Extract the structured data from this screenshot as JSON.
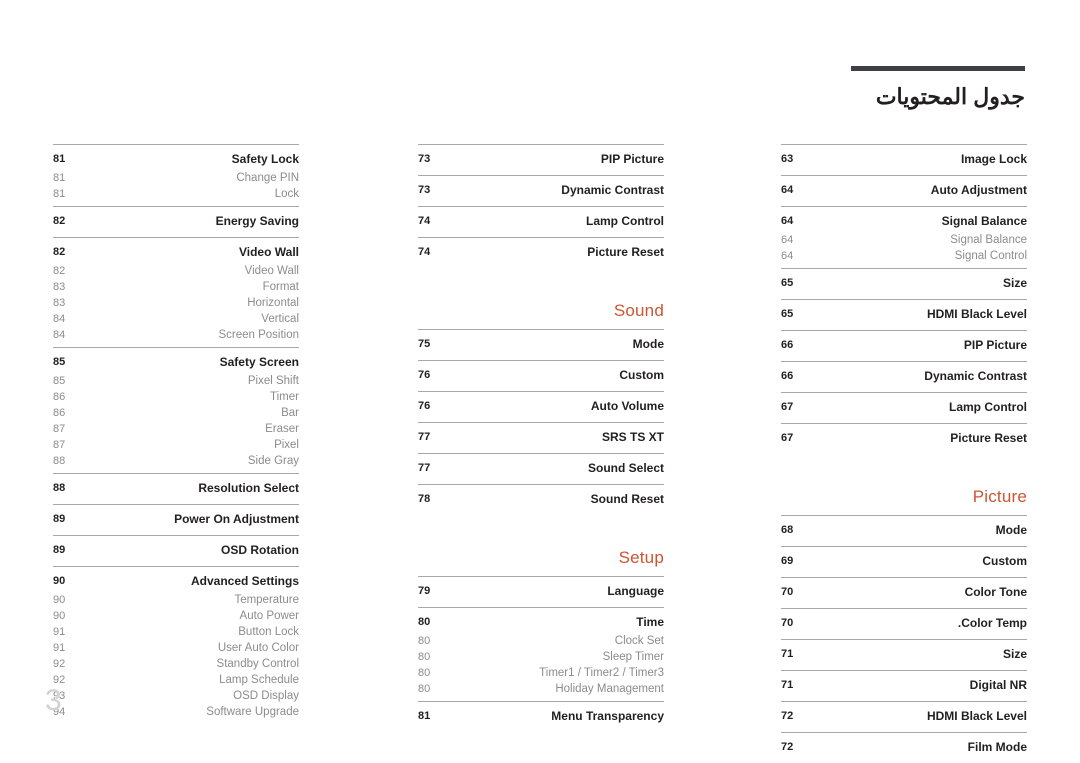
{
  "header": {
    "title": "جدول المحتويات",
    "rule_color": "#3f3f4a"
  },
  "theme": {
    "accent": "#cc5533",
    "main_text": "#231f20",
    "sub_text": "#8c8c8c",
    "rule": "#a8a8a8",
    "folio_color": "#d2d2d2",
    "background": "#ffffff"
  },
  "folio": "3",
  "columns": [
    {
      "id": "column-1",
      "sections": [
        {
          "heading": null,
          "groups": [
            {
              "rows": [
                {
                  "page": "81",
                  "label": "Safety Lock",
                  "level": "main"
                },
                {
                  "page": "81",
                  "label": "Change PIN",
                  "level": "sub"
                },
                {
                  "page": "81",
                  "label": "Lock",
                  "level": "sub"
                }
              ]
            },
            {
              "rows": [
                {
                  "page": "82",
                  "label": "Energy Saving",
                  "level": "main"
                }
              ]
            },
            {
              "rows": [
                {
                  "page": "82",
                  "label": "Video Wall",
                  "level": "main"
                },
                {
                  "page": "82",
                  "label": "Video Wall",
                  "level": "sub"
                },
                {
                  "page": "83",
                  "label": "Format",
                  "level": "sub"
                },
                {
                  "page": "83",
                  "label": "Horizontal",
                  "level": "sub"
                },
                {
                  "page": "84",
                  "label": "Vertical",
                  "level": "sub"
                },
                {
                  "page": "84",
                  "label": "Screen Position",
                  "level": "sub"
                }
              ]
            },
            {
              "rows": [
                {
                  "page": "85",
                  "label": "Safety Screen",
                  "level": "main"
                },
                {
                  "page": "85",
                  "label": "Pixel Shift",
                  "level": "sub"
                },
                {
                  "page": "86",
                  "label": "Timer",
                  "level": "sub"
                },
                {
                  "page": "86",
                  "label": "Bar",
                  "level": "sub"
                },
                {
                  "page": "87",
                  "label": "Eraser",
                  "level": "sub"
                },
                {
                  "page": "87",
                  "label": "Pixel",
                  "level": "sub"
                },
                {
                  "page": "88",
                  "label": "Side Gray",
                  "level": "sub"
                }
              ]
            },
            {
              "rows": [
                {
                  "page": "88",
                  "label": "Resolution Select",
                  "level": "main"
                }
              ]
            },
            {
              "rows": [
                {
                  "page": "89",
                  "label": "Power On Adjustment",
                  "level": "main"
                }
              ]
            },
            {
              "rows": [
                {
                  "page": "89",
                  "label": "OSD Rotation",
                  "level": "main"
                }
              ]
            },
            {
              "rows": [
                {
                  "page": "90",
                  "label": "Advanced Settings",
                  "level": "main"
                },
                {
                  "page": "90",
                  "label": "Temperature",
                  "level": "sub"
                },
                {
                  "page": "90",
                  "label": "Auto Power",
                  "level": "sub"
                },
                {
                  "page": "91",
                  "label": "Button Lock",
                  "level": "sub"
                },
                {
                  "page": "91",
                  "label": "User Auto Color",
                  "level": "sub"
                },
                {
                  "page": "92",
                  "label": "Standby Control",
                  "level": "sub"
                },
                {
                  "page": "92",
                  "label": "Lamp Schedule",
                  "level": "sub"
                },
                {
                  "page": "93",
                  "label": "OSD Display",
                  "level": "sub"
                },
                {
                  "page": "94",
                  "label": "Software Upgrade",
                  "level": "sub"
                }
              ]
            }
          ]
        }
      ]
    },
    {
      "id": "column-2",
      "sections": [
        {
          "heading": null,
          "groups": [
            {
              "rows": [
                {
                  "page": "73",
                  "label": "PIP Picture",
                  "level": "main"
                }
              ]
            },
            {
              "rows": [
                {
                  "page": "73",
                  "label": "Dynamic Contrast",
                  "level": "main"
                }
              ]
            },
            {
              "rows": [
                {
                  "page": "74",
                  "label": "Lamp Control",
                  "level": "main"
                }
              ]
            },
            {
              "rows": [
                {
                  "page": "74",
                  "label": "Picture Reset",
                  "level": "main"
                }
              ]
            }
          ]
        },
        {
          "heading": "Sound",
          "groups": [
            {
              "rows": [
                {
                  "page": "75",
                  "label": "Mode",
                  "level": "main"
                }
              ]
            },
            {
              "rows": [
                {
                  "page": "76",
                  "label": "Custom",
                  "level": "main"
                }
              ]
            },
            {
              "rows": [
                {
                  "page": "76",
                  "label": "Auto Volume",
                  "level": "main"
                }
              ]
            },
            {
              "rows": [
                {
                  "page": "77",
                  "label": "SRS TS XT",
                  "level": "main"
                }
              ]
            },
            {
              "rows": [
                {
                  "page": "77",
                  "label": "Sound Select",
                  "level": "main"
                }
              ]
            },
            {
              "rows": [
                {
                  "page": "78",
                  "label": "Sound Reset",
                  "level": "main"
                }
              ]
            }
          ]
        },
        {
          "heading": "Setup",
          "groups": [
            {
              "rows": [
                {
                  "page": "79",
                  "label": "Language",
                  "level": "main"
                }
              ]
            },
            {
              "rows": [
                {
                  "page": "80",
                  "label": "Time",
                  "level": "main"
                },
                {
                  "page": "80",
                  "label": "Clock Set",
                  "level": "sub"
                },
                {
                  "page": "80",
                  "label": "Sleep Timer",
                  "level": "sub"
                },
                {
                  "page": "80",
                  "label": "Timer1 / Timer2 / Timer3",
                  "level": "sub"
                },
                {
                  "page": "80",
                  "label": "Holiday Management",
                  "level": "sub"
                }
              ]
            },
            {
              "rows": [
                {
                  "page": "81",
                  "label": "Menu Transparency",
                  "level": "main"
                }
              ]
            }
          ]
        }
      ]
    },
    {
      "id": "column-3",
      "sections": [
        {
          "heading": null,
          "groups": [
            {
              "rows": [
                {
                  "page": "63",
                  "label": "Image Lock",
                  "level": "main"
                }
              ]
            },
            {
              "rows": [
                {
                  "page": "64",
                  "label": "Auto Adjustment",
                  "level": "main"
                }
              ]
            },
            {
              "rows": [
                {
                  "page": "64",
                  "label": "Signal Balance",
                  "level": "main"
                },
                {
                  "page": "64",
                  "label": "Signal Balance",
                  "level": "sub"
                },
                {
                  "page": "64",
                  "label": "Signal Control",
                  "level": "sub"
                }
              ]
            },
            {
              "rows": [
                {
                  "page": "65",
                  "label": "Size",
                  "level": "main"
                }
              ]
            },
            {
              "rows": [
                {
                  "page": "65",
                  "label": "HDMI Black Level",
                  "level": "main"
                }
              ]
            },
            {
              "rows": [
                {
                  "page": "66",
                  "label": "PIP Picture",
                  "level": "main"
                }
              ]
            },
            {
              "rows": [
                {
                  "page": "66",
                  "label": "Dynamic Contrast",
                  "level": "main"
                }
              ]
            },
            {
              "rows": [
                {
                  "page": "67",
                  "label": "Lamp Control",
                  "level": "main"
                }
              ]
            },
            {
              "rows": [
                {
                  "page": "67",
                  "label": "Picture Reset",
                  "level": "main"
                }
              ]
            }
          ]
        },
        {
          "heading": "Picture",
          "groups": [
            {
              "rows": [
                {
                  "page": "68",
                  "label": "Mode",
                  "level": "main"
                }
              ]
            },
            {
              "rows": [
                {
                  "page": "69",
                  "label": "Custom",
                  "level": "main"
                }
              ]
            },
            {
              "rows": [
                {
                  "page": "70",
                  "label": "Color Tone",
                  "level": "main"
                }
              ]
            },
            {
              "rows": [
                {
                  "page": "70",
                  "label": ".Color Temp",
                  "level": "main"
                }
              ]
            },
            {
              "rows": [
                {
                  "page": "71",
                  "label": "Size",
                  "level": "main"
                }
              ]
            },
            {
              "rows": [
                {
                  "page": "71",
                  "label": "Digital NR",
                  "level": "main"
                }
              ]
            },
            {
              "rows": [
                {
                  "page": "72",
                  "label": "HDMI Black Level",
                  "level": "main"
                }
              ]
            },
            {
              "rows": [
                {
                  "page": "72",
                  "label": "Film Mode",
                  "level": "main"
                }
              ]
            }
          ]
        }
      ]
    }
  ]
}
